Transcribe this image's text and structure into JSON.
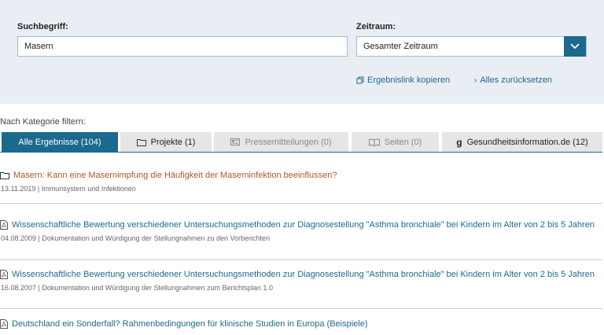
{
  "search": {
    "term_label": "Suchbegriff:",
    "term_value": "Masern",
    "period_label": "Zeitraum:",
    "period_value": "Gesamter Zeitraum",
    "copy_link": "Ergebnislink kopieren",
    "reset": "Alles zurücksetzen"
  },
  "filter": {
    "title": "Nach Kategorie filtern:",
    "tabs": [
      {
        "label": "Alle Ergebnisse (104)",
        "icon": "none",
        "active": true
      },
      {
        "label": "Projekte (1)",
        "icon": "folder-icon"
      },
      {
        "label": "Pressemitteilungen (0)",
        "icon": "newspaper-icon"
      },
      {
        "label": "Seiten (0)",
        "icon": "book-icon"
      },
      {
        "label": "Gesundheitsinformation.de (12)",
        "icon": "gi-logo-icon"
      }
    ]
  },
  "results": [
    {
      "type": "project",
      "title": "Masern: Kann eine Masernimpfung die Häufigkeit der Maserninfektion beeinflussen?",
      "meta": "13.11.2019 | Immunsystem und Infektionen"
    },
    {
      "type": "document",
      "title": "Wissenschaftliche Bewertung verschiedener Untersuchungsmethoden zur Diagnosestellung \"Asthma bronchiale\" bei Kindern im Alter von 2 bis 5 Jahren",
      "meta": "04.08.2009 | Dokumentation und Würdigung der Stellungnahmen zu den Vorberichten"
    },
    {
      "type": "document",
      "title": "Wissenschaftliche Bewertung verschiedener Untersuchungsmethoden zur Diagnosestellung \"Asthma bronchiale\" bei Kindern im Alter von 2 bis 5 Jahren",
      "meta": "16.08.2007 | Dokumentation und Würdigung der Stellungnahmen zum Berichtsplan 1.0"
    },
    {
      "type": "document",
      "title": "Deutschland ein Sonderfall? Rahmenbedingungen für klinische Studien in Europa (Beispiele)",
      "meta": ""
    }
  ],
  "colors": {
    "accent": "#1b6a8e",
    "project_title": "#b0552a",
    "panel_bg": "#e8eef3"
  }
}
